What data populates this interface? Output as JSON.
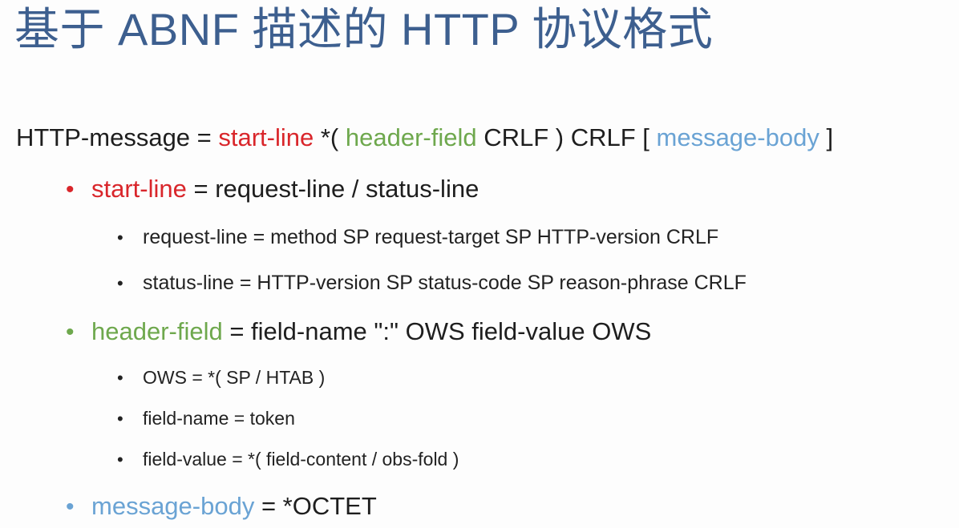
{
  "title": "基于 ABNF 描述的 HTTP 协议格式",
  "main_rule": {
    "lhs": "HTTP-message = ",
    "start_line": "start-line",
    "seg1": " *( ",
    "header_field": "header-field",
    "seg2": " CRLF ) CRLF [ ",
    "message_body": "message-body",
    "seg3": " ]"
  },
  "start_line_rule": {
    "bullet": "•",
    "name": "start-line",
    "rest": " = request-line / status-line",
    "items": [
      {
        "bullet": "•",
        "text": "request-line = method SP request-target SP HTTP-version CRLF"
      },
      {
        "bullet": "•",
        "text": "status-line = HTTP-version SP status-code SP reason-phrase CRLF"
      }
    ]
  },
  "header_field_rule": {
    "bullet": "•",
    "name": "header-field",
    "rest": " = field-name \":\" OWS field-value OWS",
    "items": [
      {
        "bullet": "•",
        "text": "OWS = *( SP / HTAB )"
      },
      {
        "bullet": "•",
        "text": "field-name = token"
      },
      {
        "bullet": "•",
        "text": "field-value = *( field-content / obs-fold )"
      }
    ]
  },
  "message_body_rule": {
    "bullet": "•",
    "name": "message-body",
    "rest": " = *OCTET"
  },
  "colors": {
    "title": "#3d5f8f",
    "red": "#d9262b",
    "green": "#6ea84d",
    "blue": "#6aa3d4"
  }
}
